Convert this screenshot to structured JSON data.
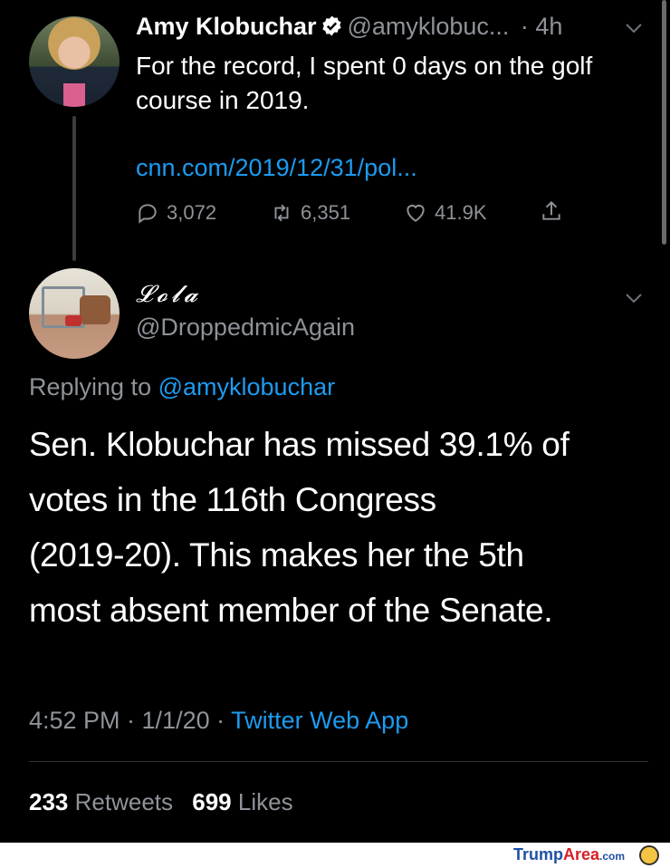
{
  "tweet1": {
    "name": "Amy Klobuchar",
    "handle": "@amyklobuc...",
    "time": "· 4h",
    "text_line1": "For the record, I spent 0 days on the golf",
    "text_line2": "course in 2019.",
    "link": "cnn.com/2019/12/31/pol...",
    "replies": "3,072",
    "retweets": "6,351",
    "likes": "41.9K"
  },
  "tweet2": {
    "name": "𝓛𝓸𝓵𝓪",
    "handle": "@DroppedmicAgain",
    "replying_prefix": "Replying to",
    "replying_to": "@amyklobuchar",
    "lines": [
      "Sen. Klobuchar has missed 39.1% of",
      "votes in the 116th Congress",
      "(2019-20). This makes her the 5th",
      "most absent member of the Senate."
    ],
    "time": "4:52 PM · 1/1/20 · ",
    "app": "Twitter Web App",
    "retweet_count": "233",
    "retweet_label": "Retweets",
    "like_count": "699",
    "like_label": "Likes"
  },
  "footer": {
    "brand_trump": "Trump",
    "brand_area": "Area",
    "brand_com": ".com"
  },
  "colors": {
    "background": "#000000",
    "link": "#1d9bf0",
    "muted": "#8e9399",
    "verified": "#ffffff"
  }
}
